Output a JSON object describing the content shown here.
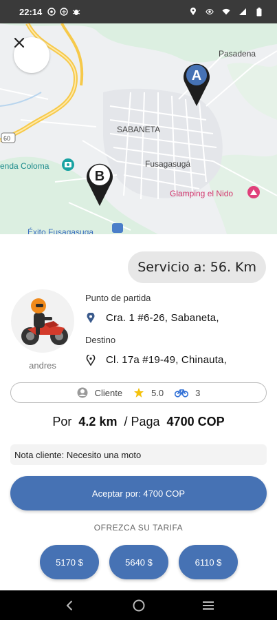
{
  "status_bar": {
    "time": "22:14",
    "left_icons": [
      "chat-bubble-icon",
      "circle-icon",
      "bug-icon"
    ],
    "right_icons": [
      "location-icon",
      "eye-icon",
      "wifi-icon",
      "signal-icon",
      "battery-icon"
    ]
  },
  "map": {
    "labels": {
      "pasadena": "Pasadena",
      "sabaneta": "SABANETA",
      "fusagasuga": "Fusagasugá",
      "tienda_coloma": "enda Coloma",
      "glamping": "Glamping el Nido",
      "exito": "Éxito Fusagasuga",
      "route_badge": "60"
    },
    "marker_a": "A",
    "marker_b": "B"
  },
  "ride": {
    "service_distance": "Servicio a: 56. Km",
    "driver_name": "andres",
    "origin_label": "Punto de partida",
    "origin_address": "Cra. 1 #6-26, Sabaneta,",
    "destination_label": "Destino",
    "destination_address": "Cl. 17a #19-49, Chinauta,",
    "client_label": "Cliente",
    "rating": "5.0",
    "trips": "3",
    "offer_prefix": "Por",
    "offer_distance": "4.2 km",
    "offer_middle": "/ Paga",
    "offer_amount": "4700 COP",
    "client_note": "Nota cliente: Necesito una moto",
    "accept_label": "Aceptar por: 4700 COP",
    "offer_title": "OFREZCA SU TARIFA",
    "fares": [
      "5170 $",
      "5640 $",
      "6110 $"
    ]
  },
  "colors": {
    "accent": "#4672b4",
    "star": "#f4c20d",
    "glamping": "#e0407a",
    "route_yellow": "#f6c94a"
  }
}
